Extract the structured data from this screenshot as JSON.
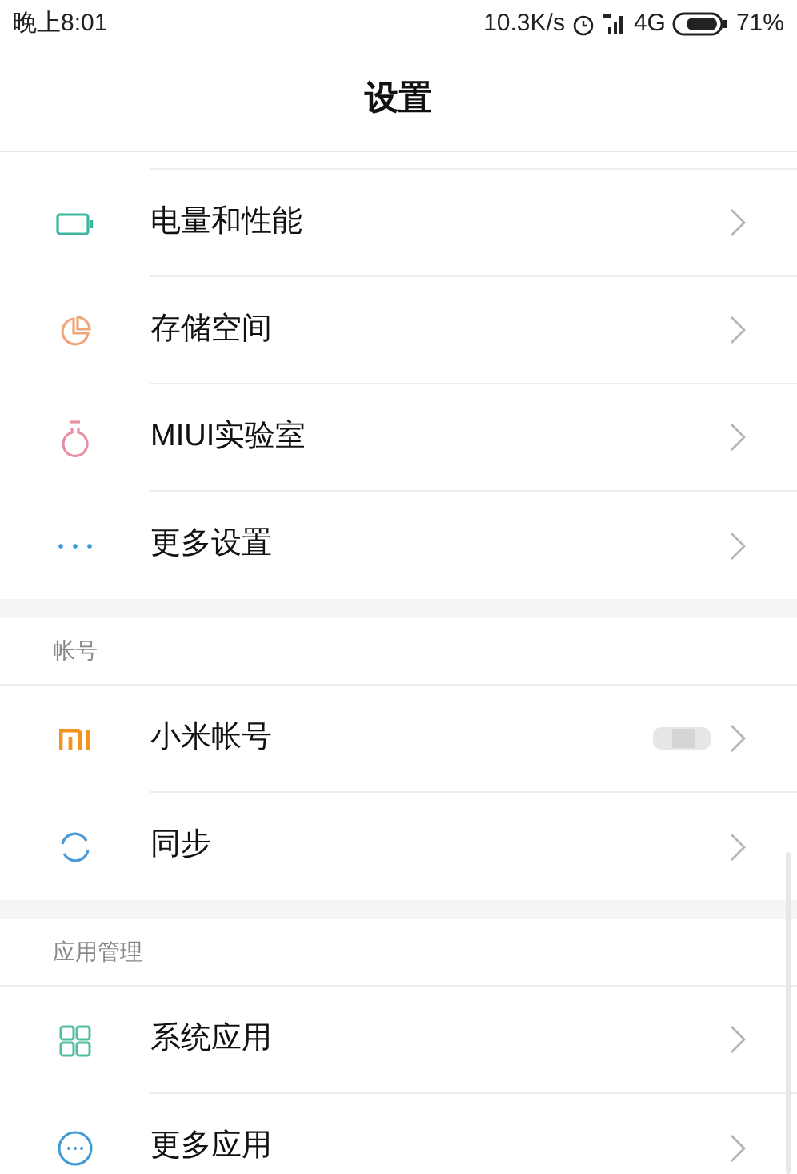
{
  "status_bar": {
    "time": "晚上8:01",
    "speed": "10.3K/s",
    "network": "4G",
    "battery": "71%"
  },
  "title": "设置",
  "sections": [
    {
      "items": [
        {
          "kind": "battery",
          "label": "电量和性能"
        },
        {
          "kind": "pie",
          "label": "存储空间"
        },
        {
          "kind": "flask",
          "label": "MIUI实验室"
        },
        {
          "kind": "dots",
          "label": "更多设置"
        }
      ]
    },
    {
      "header": "帐号",
      "items": [
        {
          "kind": "mi",
          "label": "小米帐号",
          "redacted": true
        },
        {
          "kind": "sync",
          "label": "同步"
        }
      ]
    },
    {
      "header": "应用管理",
      "items": [
        {
          "kind": "grid",
          "label": "系统应用"
        },
        {
          "kind": "more",
          "label": "更多应用"
        }
      ]
    }
  ]
}
